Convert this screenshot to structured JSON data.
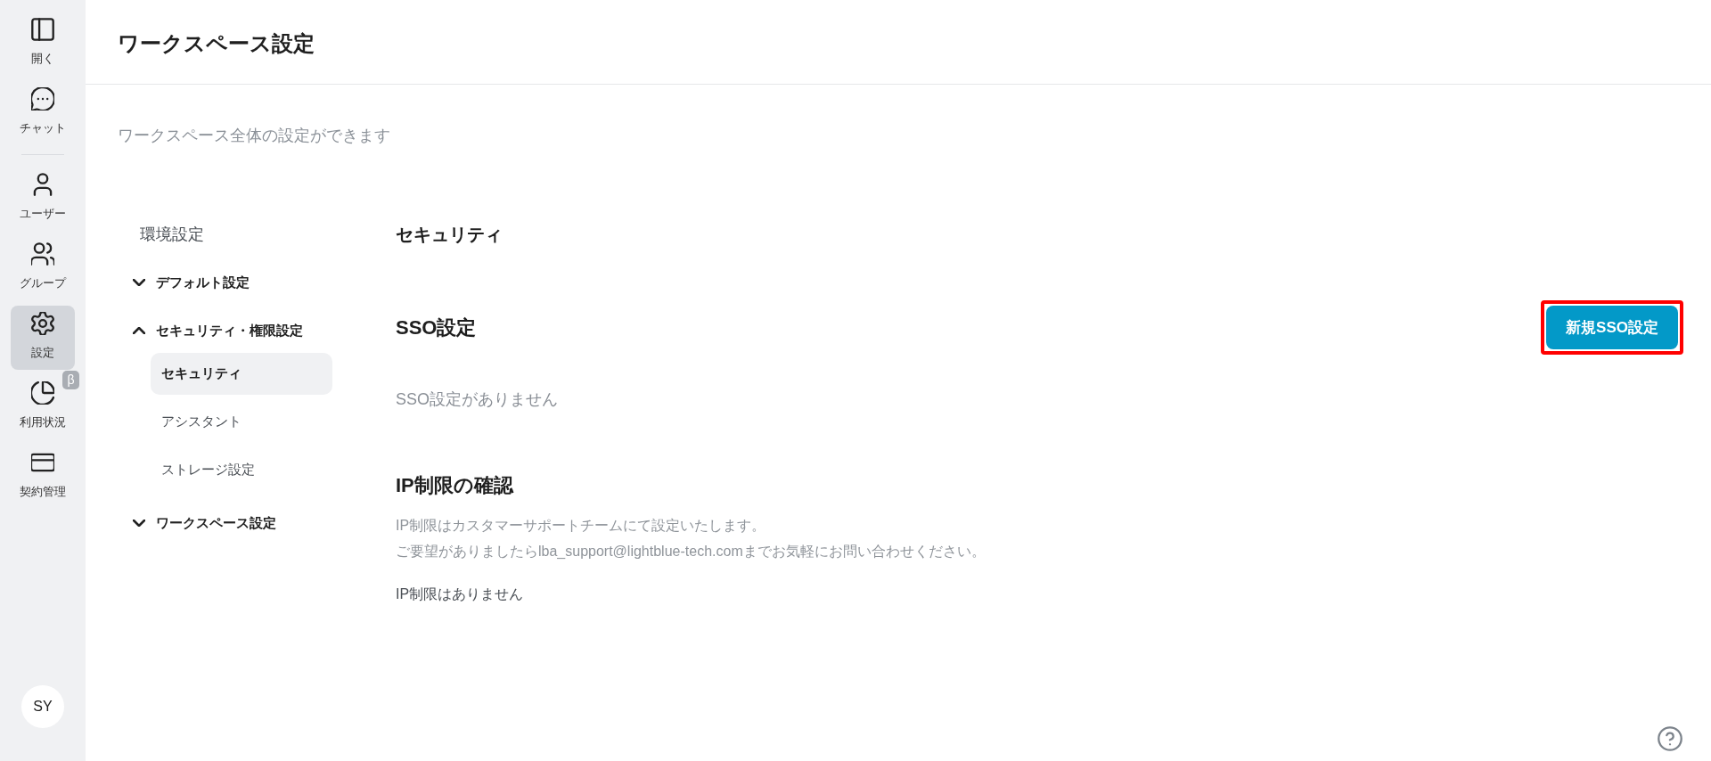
{
  "sidebar": {
    "sections": [
      {
        "items": [
          {
            "label": "開く",
            "selected": false
          },
          {
            "label": "チャット",
            "selected": false
          }
        ]
      },
      {
        "items": [
          {
            "label": "ユーザー",
            "selected": false
          },
          {
            "label": "グループ",
            "selected": false
          },
          {
            "label": "設定",
            "selected": true
          },
          {
            "label": "利用状況",
            "selected": false,
            "badge": "β"
          },
          {
            "label": "契約管理",
            "selected": false
          }
        ]
      }
    ],
    "avatar": {
      "initials": "SY"
    }
  },
  "header": {
    "title": "ワークスペース設定"
  },
  "subtitle": "ワークスペース全体の設定ができます",
  "settings_nav": {
    "title": "環境設定",
    "groups": [
      {
        "label": "デフォルト設定",
        "expanded": false
      },
      {
        "label": "セキュリティ・権限設定",
        "expanded": true,
        "children": [
          {
            "label": "セキュリティ",
            "selected": true
          },
          {
            "label": "アシスタント",
            "selected": false
          },
          {
            "label": "ストレージ設定",
            "selected": false
          }
        ]
      },
      {
        "label": "ワークスペース設定",
        "expanded": false
      }
    ]
  },
  "content": {
    "title": "セキュリティ",
    "sso": {
      "heading": "SSO設定",
      "button": {
        "label": "新規SSO設定",
        "highlighted": true
      },
      "empty_text": "SSO設定がありません"
    },
    "ip": {
      "heading": "IP制限の確認",
      "description": [
        "IP制限はカスタマーサポートチームにて設定いたします。",
        "ご要望がありましたらlba_support@lightblue-tech.comまでお気軽にお問い合わせください。"
      ],
      "status": "IP制限はありません"
    }
  }
}
